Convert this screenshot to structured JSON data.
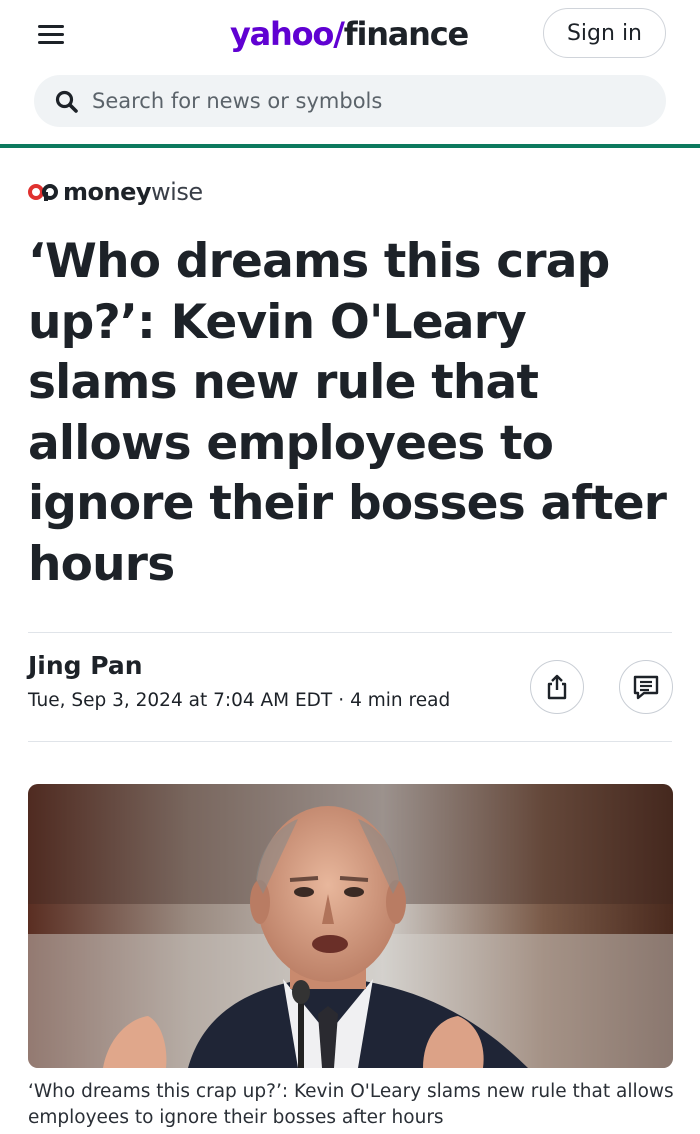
{
  "header": {
    "logo_yahoo": "yahoo",
    "logo_slash": "/",
    "logo_finance": "finance",
    "signin_label": "Sign in",
    "brand_color": "#6001d2",
    "accent_bar_color": "#0d7a5e"
  },
  "search": {
    "placeholder": "Search for news or symbols",
    "icon": "search-icon"
  },
  "source": {
    "name_bold": "money",
    "name_light": "wise"
  },
  "article": {
    "headline": "‘Who dreams this crap up?’: Kevin O'Leary slams new rule that allows employees to ignore their bosses after hours",
    "author": "Jing Pan",
    "date": "Tue, Sep 3, 2024 at 7:04 AM EDT",
    "separator": "·",
    "read_time": "4 min read",
    "share_icon": "share-icon",
    "comments_icon": "comments-icon",
    "image_caption": "‘Who dreams this crap up?’: Kevin O'Leary slams new rule that allows employees to ignore their bosses after hours"
  }
}
